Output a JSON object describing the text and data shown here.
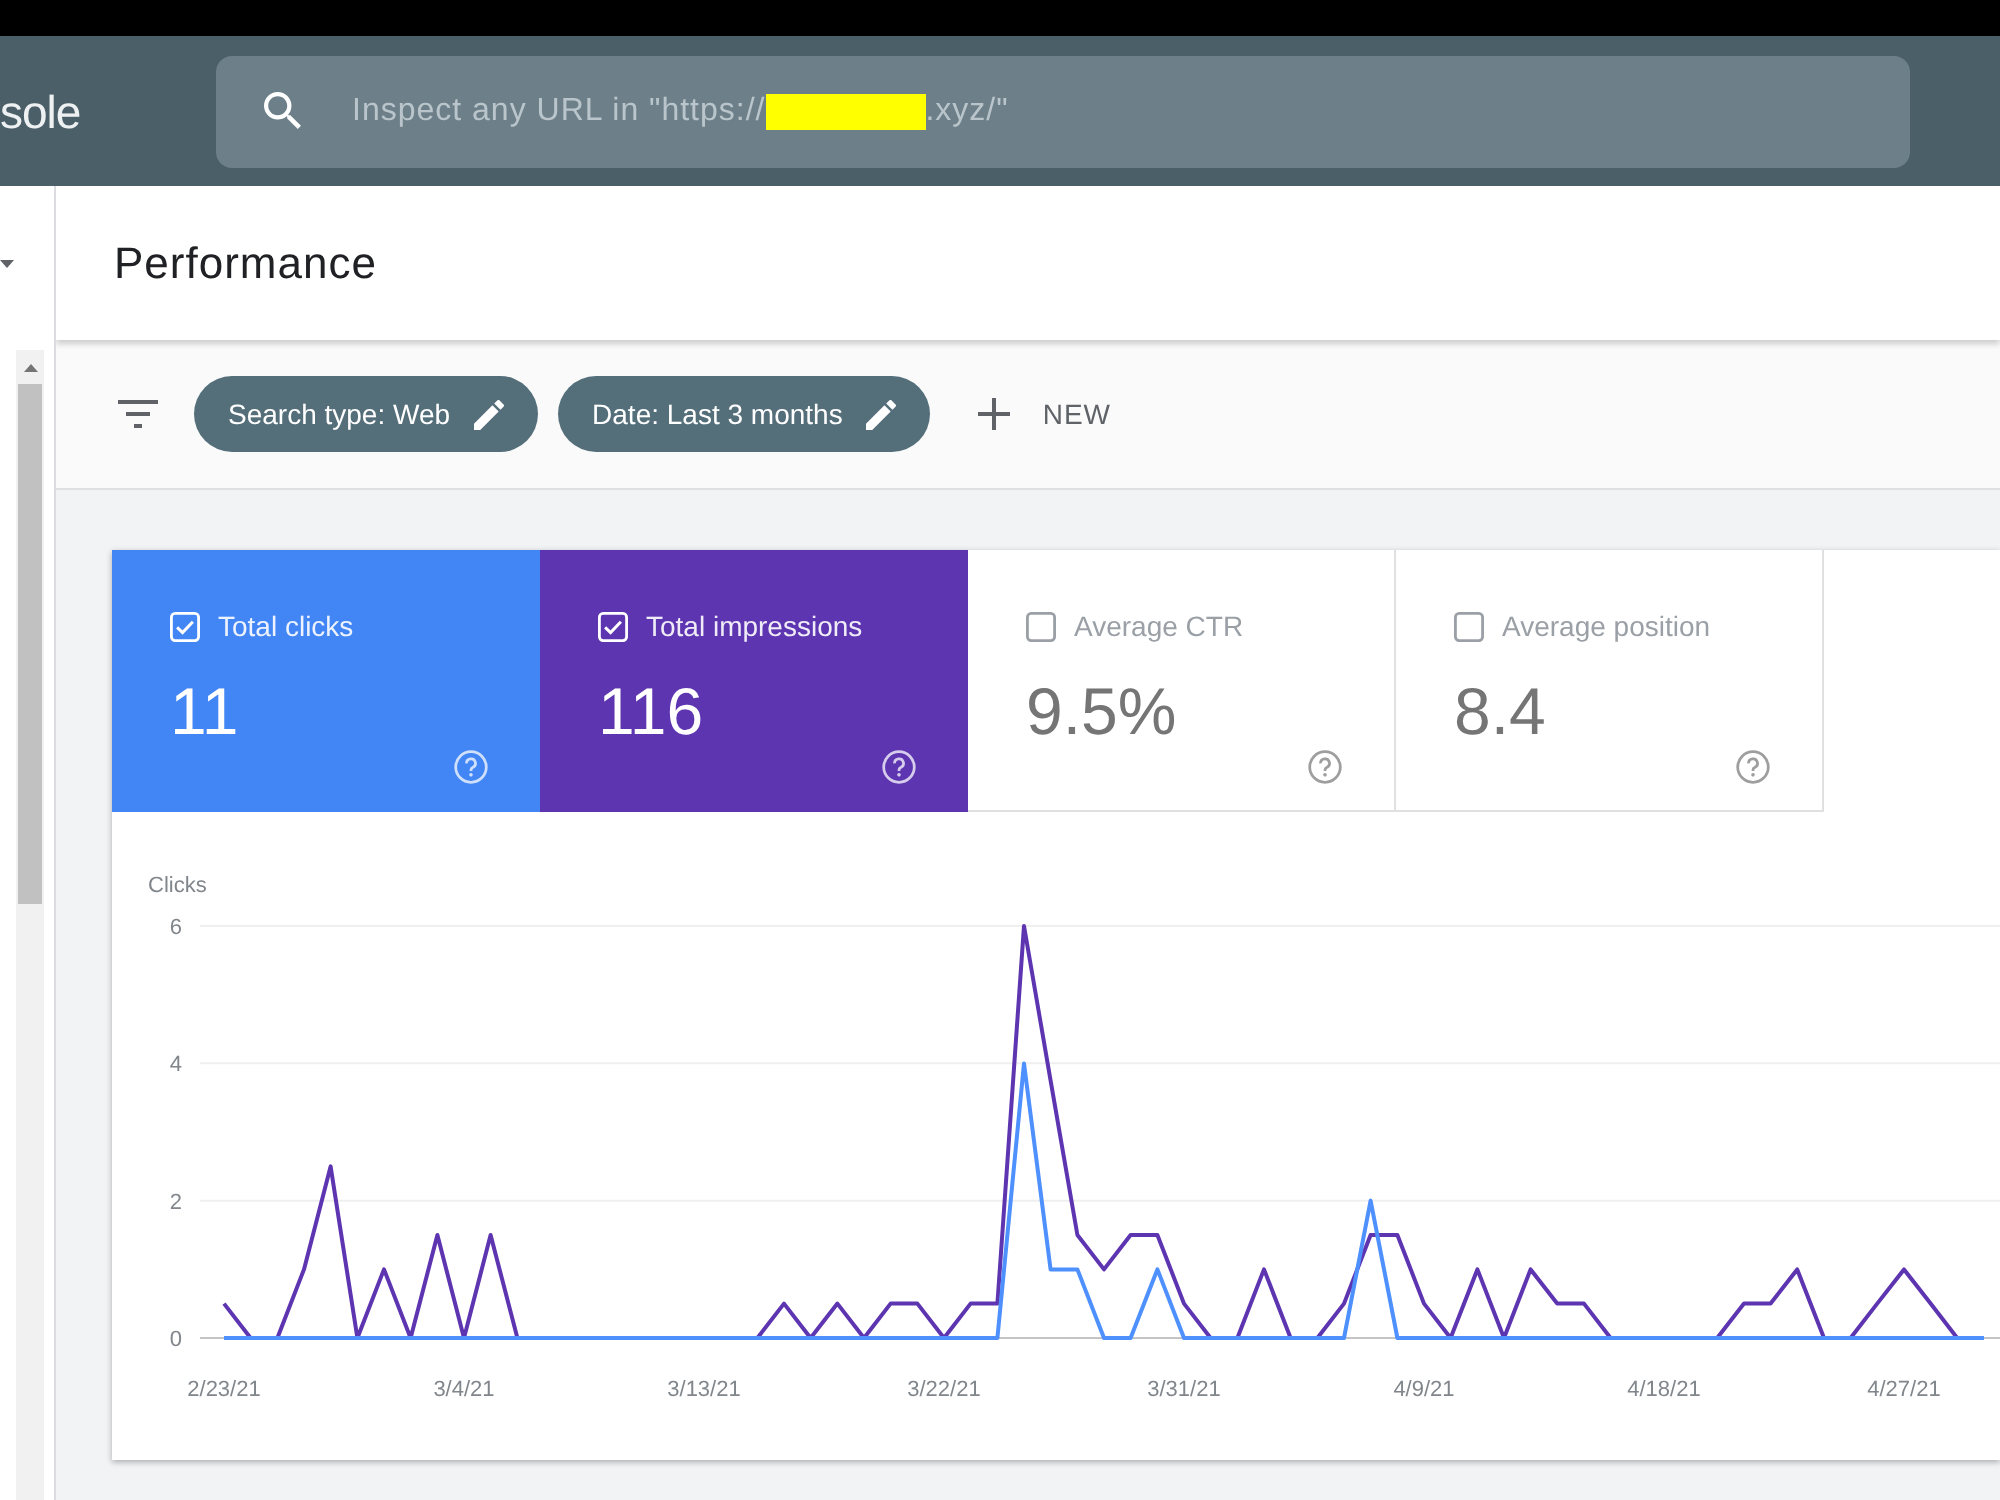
{
  "header": {
    "logo_text": "sole",
    "search": {
      "placeholder": "Inspect any URL in \"https://",
      "redacted": true,
      "placeholder_end": ".xyz/\""
    }
  },
  "page": {
    "title": "Performance"
  },
  "filters": {
    "chips": [
      {
        "label": "Search type: Web"
      },
      {
        "label": "Date: Last 3 months"
      }
    ],
    "new_label": "NEW"
  },
  "metrics": [
    {
      "label": "Total clicks",
      "value": "11",
      "selected": true,
      "color": "#4285f4"
    },
    {
      "label": "Total impressions",
      "value": "116",
      "selected": true,
      "color": "#5e35b1"
    },
    {
      "label": "Average CTR",
      "value": "9.5%",
      "selected": false
    },
    {
      "label": "Average position",
      "value": "8.4",
      "selected": false
    }
  ],
  "chart": {
    "chart_data": {
      "type": "line",
      "ylabel": "Clicks",
      "categories": [
        "2/23/21",
        null,
        null,
        null,
        null,
        null,
        null,
        null,
        null,
        "3/4/21",
        null,
        null,
        null,
        null,
        null,
        null,
        null,
        null,
        "3/13/21",
        null,
        null,
        null,
        null,
        null,
        null,
        null,
        null,
        "3/22/21",
        null,
        null,
        null,
        null,
        null,
        null,
        null,
        null,
        "3/31/21",
        null,
        null,
        null,
        null,
        null,
        null,
        null,
        null,
        "4/9/21",
        null,
        null,
        null,
        null,
        null,
        null,
        null,
        null,
        "4/18/21",
        null,
        null,
        null,
        null,
        null,
        null,
        null,
        null,
        "4/27/21",
        null,
        null,
        null
      ],
      "series": [
        {
          "color": "#4d90fe",
          "values": [
            0,
            0,
            0,
            0,
            0,
            0,
            0,
            0,
            0,
            0,
            0,
            0,
            0,
            0,
            0,
            0,
            0,
            0,
            0,
            0,
            0,
            0,
            0,
            0,
            0,
            0,
            0,
            0,
            0,
            0,
            4,
            1,
            1,
            0,
            0,
            1,
            0,
            0,
            0,
            0,
            0,
            0,
            0,
            2,
            0,
            0,
            0,
            0,
            0,
            0,
            0,
            0,
            0,
            0,
            0,
            0,
            0,
            0,
            0,
            0,
            0,
            0,
            0,
            0,
            0,
            0,
            0
          ]
        },
        {
          "color": "#5e35b1",
          "values": [
            0.5,
            0,
            0,
            1,
            2.5,
            0,
            1,
            0,
            1.5,
            0,
            1.5,
            0,
            0,
            0,
            0,
            0,
            0,
            0,
            0,
            0,
            0,
            0.5,
            0,
            0.5,
            0,
            0.5,
            0.5,
            0,
            0.5,
            0.5,
            6,
            3.75,
            1.5,
            1,
            1.5,
            1.5,
            0.5,
            0,
            0,
            1,
            0,
            0,
            0.5,
            1.5,
            1.5,
            0.5,
            0,
            1,
            0,
            1,
            0.5,
            0.5,
            0,
            0,
            0,
            0,
            0,
            0.5,
            0.5,
            1,
            0,
            0,
            0.5,
            1,
            0.5,
            0,
            0
          ]
        }
      ],
      "ylim": [
        0,
        6
      ],
      "yticks": [
        0,
        2,
        4,
        6
      ]
    }
  }
}
